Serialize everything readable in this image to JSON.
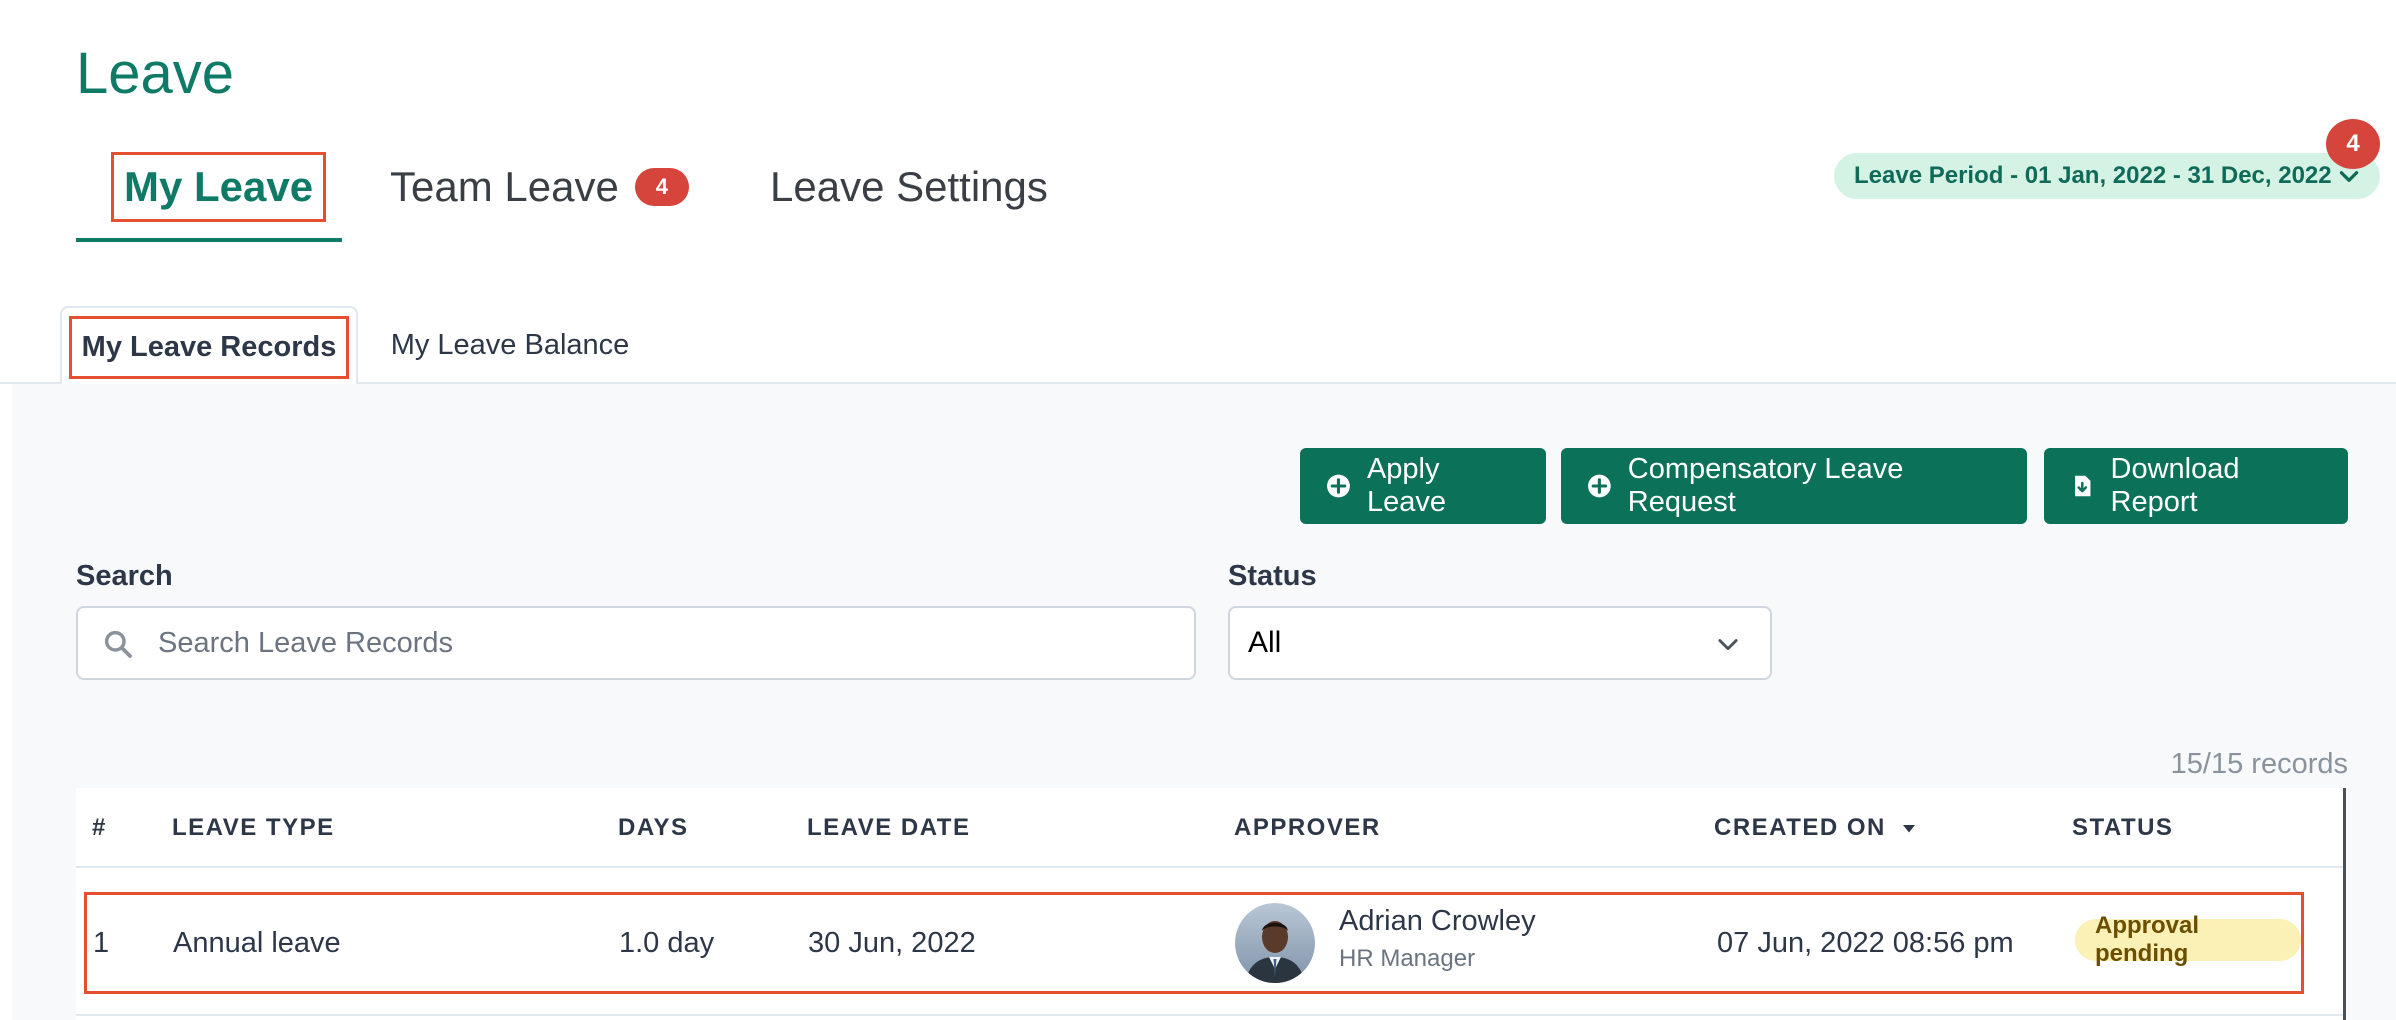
{
  "page": {
    "title": "Leave"
  },
  "main_tabs": [
    {
      "label": "My Leave"
    },
    {
      "label": "Team Leave",
      "badge": "4"
    },
    {
      "label": "Leave Settings"
    }
  ],
  "leave_period": {
    "label": "Leave Period - 01 Jan, 2022 - 31 Dec, 2022",
    "badge": "4"
  },
  "sub_tabs": [
    {
      "label": "My Leave Records"
    },
    {
      "label": "My Leave Balance"
    }
  ],
  "actions": {
    "apply_leave": "Apply Leave",
    "compensatory": "Compensatory Leave Request",
    "download_report": "Download Report"
  },
  "filters": {
    "search_label": "Search",
    "search_placeholder": "Search Leave Records",
    "status_label": "Status",
    "status_value": "All"
  },
  "records_count": "15/15 records",
  "table": {
    "headers": [
      "#",
      "LEAVE TYPE",
      "DAYS",
      "LEAVE DATE",
      "APPROVER",
      "CREATED ON",
      "STATUS"
    ],
    "rows": [
      {
        "index": "1",
        "leave_type": "Annual leave",
        "days": "1.0 day",
        "leave_date": "30 Jun, 2022",
        "approver_name": "Adrian Crowley",
        "approver_role": "HR Manager",
        "created_on": "07 Jun, 2022 08:56 pm",
        "status": "Approval pending"
      }
    ]
  },
  "colors": {
    "brand": "#0f7a66",
    "button": "#0c7159",
    "badge": "#d6453c",
    "highlight": "#e4502f",
    "pending": "#fbf0b5"
  }
}
